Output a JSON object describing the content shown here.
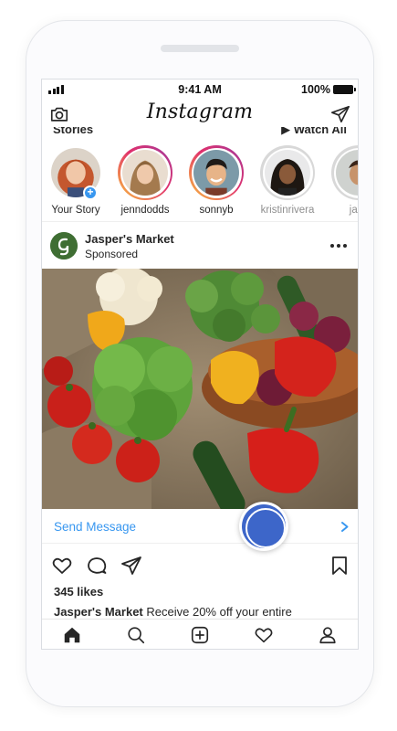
{
  "status_bar": {
    "time": "9:41 AM",
    "battery": "100%"
  },
  "header": {
    "app_title": "Instagram",
    "left_icon": "camera-icon",
    "right_icon": "direct-send-icon"
  },
  "stories_section": {
    "label": "Stories",
    "watch_all": "▶ Watch All"
  },
  "stories": [
    {
      "label": "Your Story"
    },
    {
      "label": "jenndodds"
    },
    {
      "label": "sonnyb"
    },
    {
      "label": "kristinrivera"
    },
    {
      "label": "jack"
    }
  ],
  "post": {
    "account": "Jasper's Market",
    "subtitle": "Sponsored",
    "more_icon": "more-options-icon",
    "cta_label": "Send Message",
    "likes": "345 likes",
    "caption_user": "Jasper's Market",
    "caption_text": "Receive 20% off your entire"
  },
  "tab_bar": [
    "home-icon",
    "search-icon",
    "new-post-icon",
    "activity-heart-icon",
    "profile-icon"
  ],
  "colors": {
    "link_blue": "#3897f0",
    "record_button": "#3d66c9",
    "brand_green": "#3f6e33"
  }
}
